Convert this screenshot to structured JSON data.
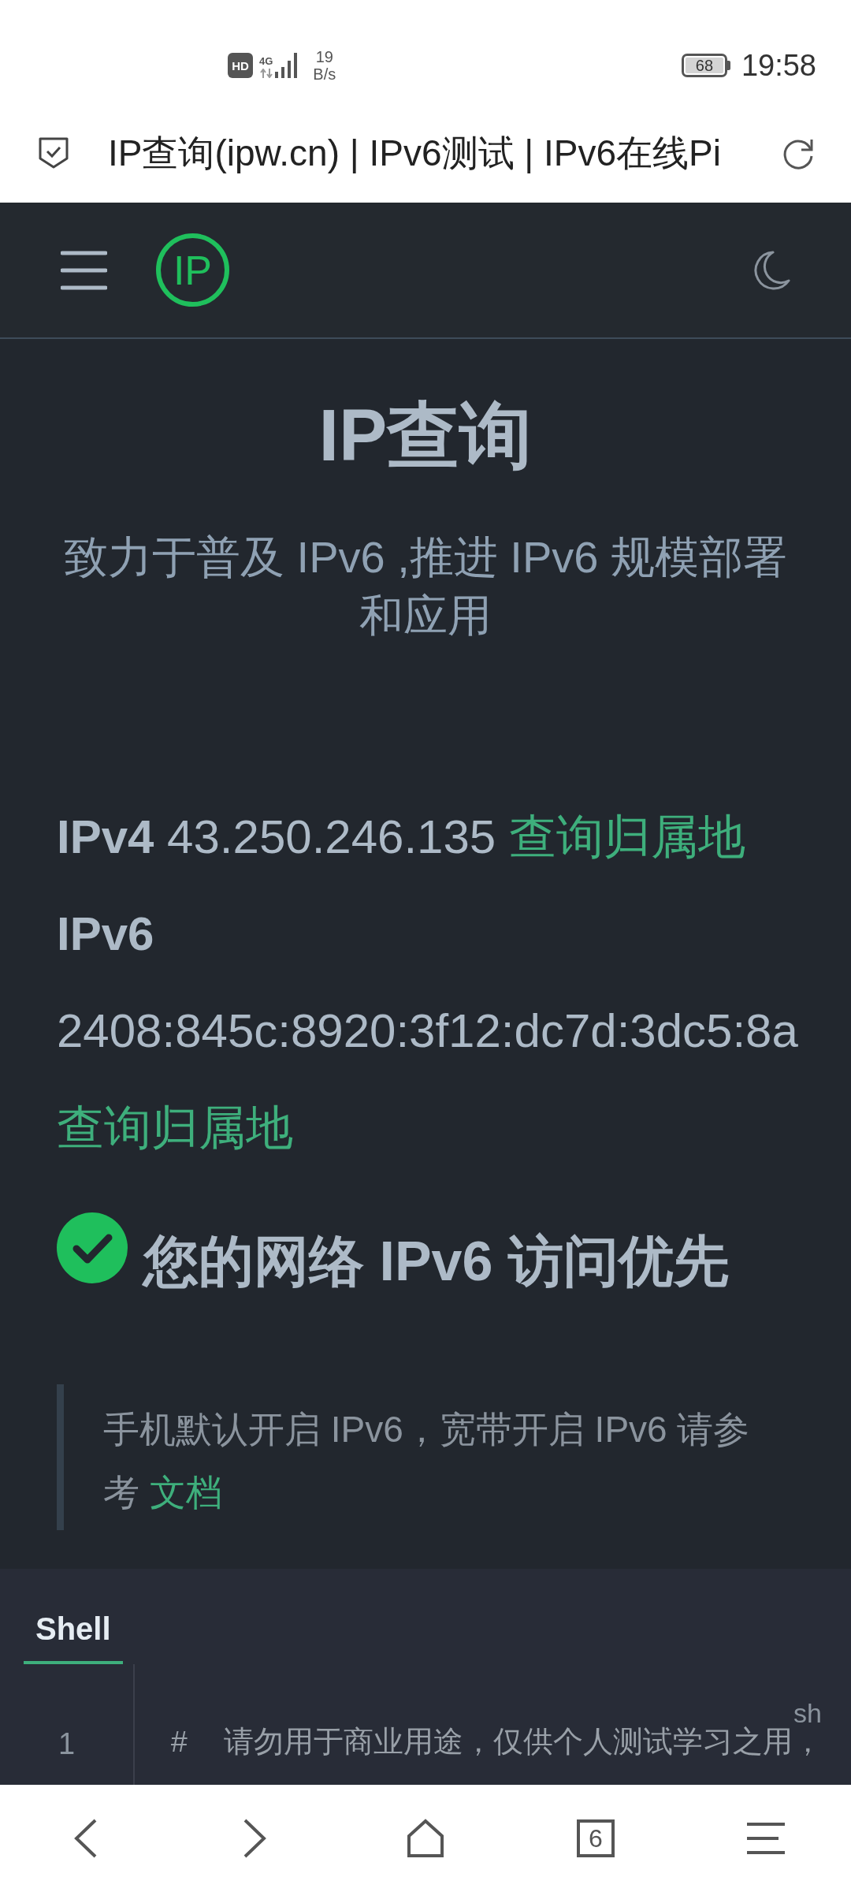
{
  "status_bar": {
    "badge": "HD",
    "network_type": "4G",
    "speed_value": "19",
    "speed_unit": "B/s",
    "battery": "68",
    "time": "19:58"
  },
  "address_bar": {
    "page_title": "IP查询(ipw.cn) | IPv6测试 | IPv6在线Pi"
  },
  "navbar": {
    "logo": "IP"
  },
  "hero": {
    "title": "IP查询",
    "description": "致力于普及 IPv6 ,推进 IPv6 规模部署和应用"
  },
  "addresses": [
    {
      "label": "IPv4",
      "value": "43.250.246.135",
      "link": "查询归属地"
    },
    {
      "label": "IPv6",
      "value": "2408:845c:8920:3f12:dc7d:3dc5:8a",
      "link": "查询归属地"
    }
  ],
  "status": {
    "passed": true,
    "text": "您的网络 IPv6 访问优先"
  },
  "note": {
    "text": "手机默认开启 IPv6，宽带开启 IPv6 请参考",
    "link": "文档"
  },
  "code": {
    "tabs": [
      {
        "label": "Shell",
        "selected": true
      }
    ],
    "language": "sh",
    "lines": [
      {
        "number": "1",
        "text": "#  请勿用于商业用途，仅供个人测试学习之用，"
      }
    ]
  },
  "bottom_bar": {
    "tab_count": "6"
  }
}
